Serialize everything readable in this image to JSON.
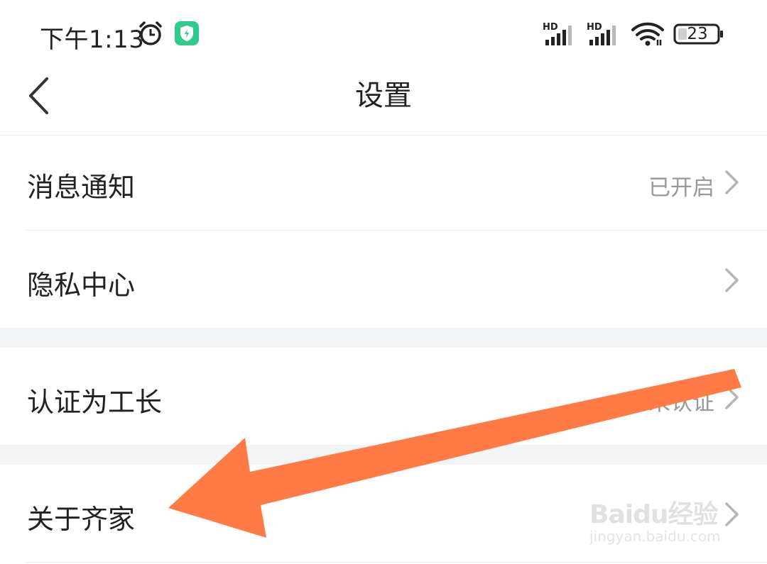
{
  "status_bar": {
    "time": "下午1:13",
    "network_badge_1": "HD",
    "network_badge_2": "HD",
    "battery": "23"
  },
  "nav": {
    "title": "设置"
  },
  "rows": [
    {
      "label": "消息通知",
      "value": "已开启"
    },
    {
      "label": "隐私中心",
      "value": ""
    },
    {
      "label": "认证为工长",
      "value": "未认证"
    },
    {
      "label": "关于齐家",
      "value": ""
    }
  ],
  "watermark": {
    "main": "Baidu经验",
    "sub": "jingyan.baidu.com"
  },
  "colors": {
    "accent_green": "#2ecb8a",
    "arrow": "#ff7a45",
    "section_gap": "#f3f4f6"
  },
  "icons": [
    "alarm-icon",
    "shield-app-icon",
    "signal-icon",
    "wifi-icon",
    "battery-icon",
    "back-icon",
    "chevron-right-icon",
    "arrow-annotation"
  ]
}
